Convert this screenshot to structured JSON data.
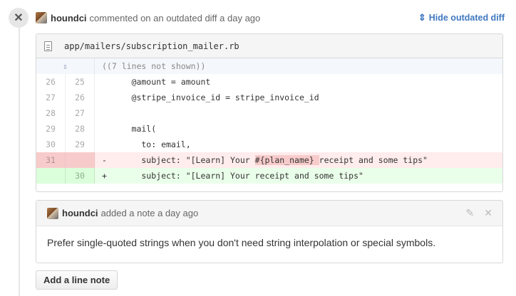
{
  "comment": {
    "author": "houndci",
    "action_text": "commented on an outdated diff a day ago",
    "hide_link": "Hide outdated diff"
  },
  "diff": {
    "file_path": "app/mailers/subscription_mailer.rb",
    "hunk_text": "((7 lines not shown))",
    "rows": [
      {
        "old": "26",
        "new": "25",
        "sign": "",
        "code": "    @amount = amount",
        "type": "context"
      },
      {
        "old": "27",
        "new": "26",
        "sign": "",
        "code": "    @stripe_invoice_id = stripe_invoice_id",
        "type": "context"
      },
      {
        "old": "28",
        "new": "27",
        "sign": "",
        "code": "",
        "type": "context"
      },
      {
        "old": "29",
        "new": "28",
        "sign": "",
        "code": "    mail(",
        "type": "context"
      },
      {
        "old": "30",
        "new": "29",
        "sign": "",
        "code": "      to: email,",
        "type": "context"
      },
      {
        "old": "31",
        "new": "",
        "sign": "-",
        "code_before": "      subject: \"[Learn] Your ",
        "code_highlight": "#{plan_name} ",
        "code_after": "receipt and some tips\"",
        "type": "del"
      },
      {
        "old": "",
        "new": "30",
        "sign": "+",
        "code": "      subject: \"[Learn] Your receipt and some tips\"",
        "type": "add"
      }
    ]
  },
  "note": {
    "author": "houndci",
    "action_text": "added a note a day ago",
    "body": "Prefer single-quoted strings when you don't need string interpolation or special symbols."
  },
  "add_note_button": "Add a line note",
  "icons": [
    "close-icon",
    "expand-diff-icon",
    "file-icon",
    "pencil-icon",
    "avatar"
  ]
}
